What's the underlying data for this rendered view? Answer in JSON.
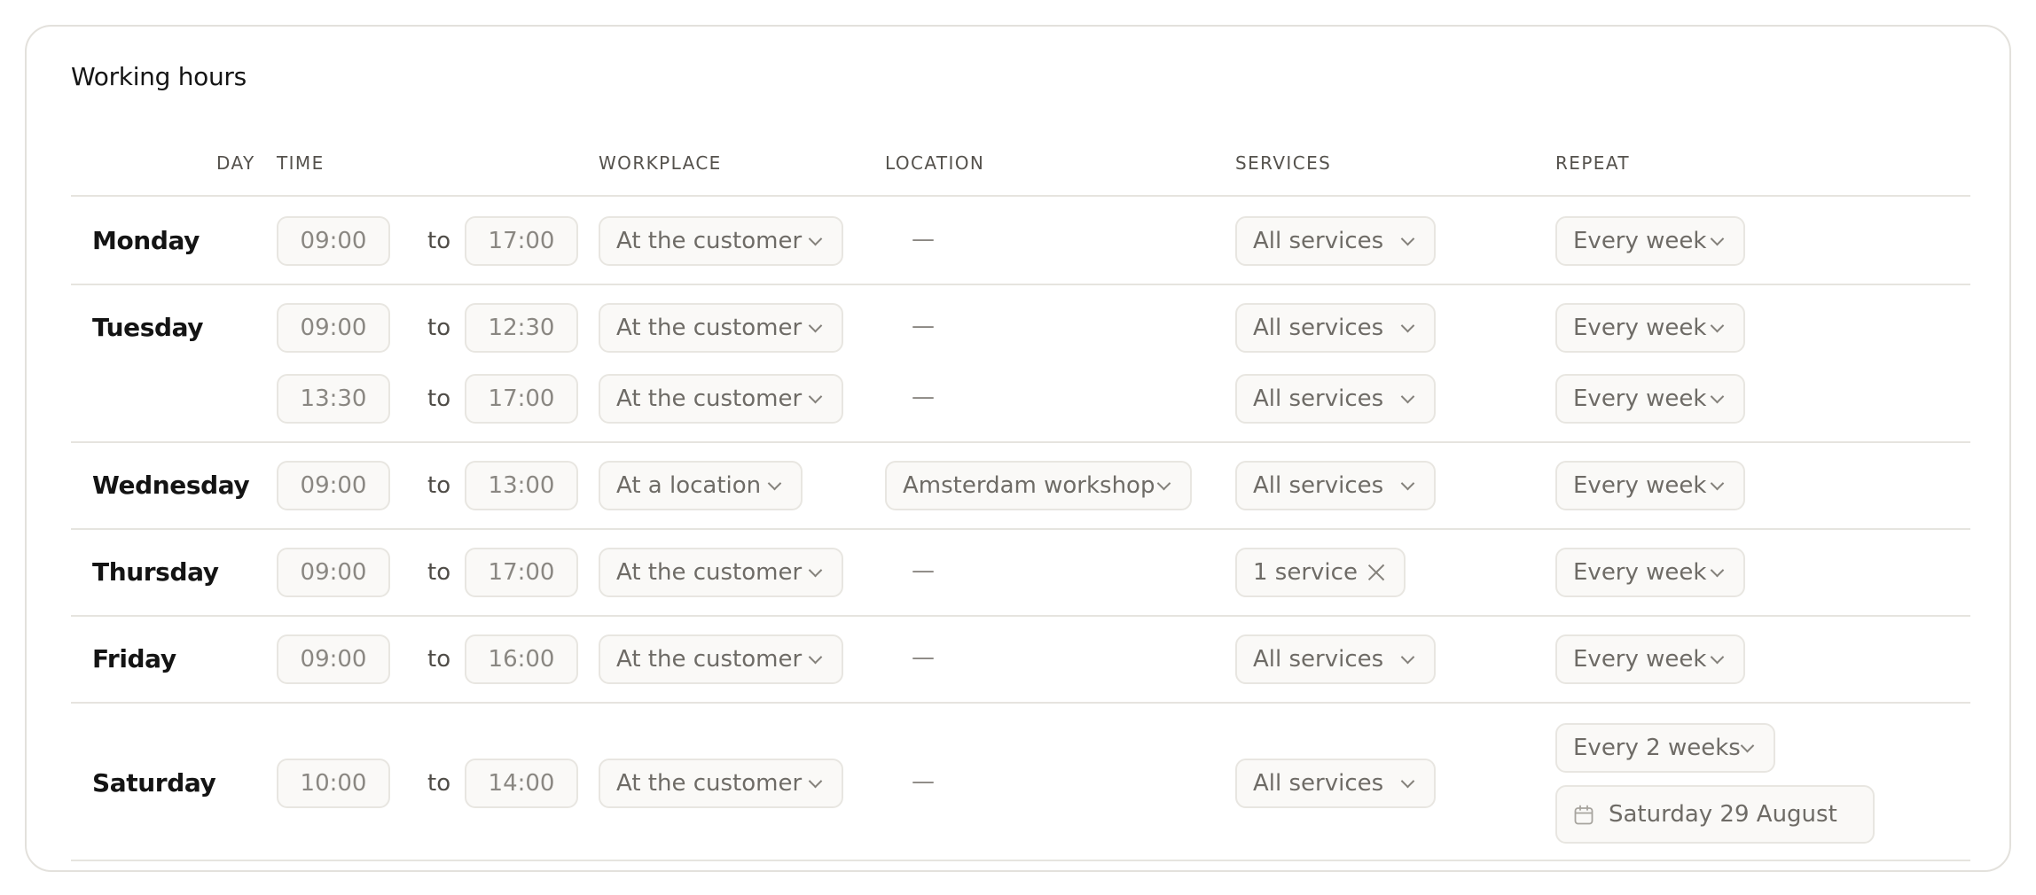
{
  "title": "Working hours",
  "columns": {
    "day": "DAY",
    "time": "TIME",
    "workplace": "WORKPLACE",
    "location": "LOCATION",
    "services": "SERVICES",
    "repeat": "REPEAT"
  },
  "to_label": "to",
  "empty_location": "—",
  "rows": [
    {
      "day": "Monday",
      "slots": [
        {
          "start": "09:00",
          "end": "17:00",
          "workplace": "At the customer",
          "location": "—",
          "services": "All services",
          "repeat": "Every week"
        }
      ]
    },
    {
      "day": "Tuesday",
      "slots": [
        {
          "start": "09:00",
          "end": "12:30",
          "workplace": "At the customer",
          "location": "—",
          "services": "All services",
          "repeat": "Every week"
        },
        {
          "start": "13:30",
          "end": "17:00",
          "workplace": "At the customer",
          "location": "—",
          "services": "All services",
          "repeat": "Every week"
        }
      ]
    },
    {
      "day": "Wednesday",
      "slots": [
        {
          "start": "09:00",
          "end": "13:00",
          "workplace": "At a location",
          "location": "Amsterdam workshop",
          "services": "All services",
          "repeat": "Every week"
        }
      ]
    },
    {
      "day": "Thursday",
      "slots": [
        {
          "start": "09:00",
          "end": "17:00",
          "workplace": "At the customer",
          "location": "—",
          "services": "1 service",
          "repeat": "Every week"
        }
      ]
    },
    {
      "day": "Friday",
      "slots": [
        {
          "start": "09:00",
          "end": "16:00",
          "workplace": "At the customer",
          "location": "—",
          "services": "All services",
          "repeat": "Every week"
        }
      ]
    },
    {
      "day": "Saturday",
      "slots": [
        {
          "start": "10:00",
          "end": "14:00",
          "workplace": "At the customer",
          "location": "—",
          "services": "All services",
          "repeat": "Every 2 weeks",
          "repeat_start_date": "Saturday 29 August"
        }
      ]
    }
  ]
}
